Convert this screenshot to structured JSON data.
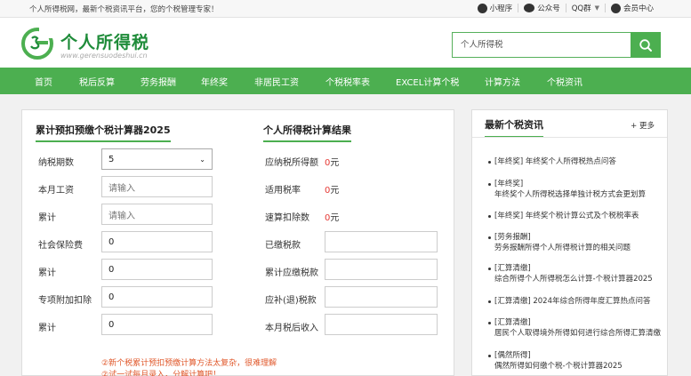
{
  "topbar": {
    "slogan": "个人所得税网，最新个税资讯平台，您的个税管理专家！",
    "miniprogram": "小程序",
    "official_account": "公众号",
    "qq_group": "QQ群",
    "member_center": "会员中心"
  },
  "header": {
    "site_title": "个人所得税",
    "site_url": "www.gerensuodeshui.cn",
    "search_placeholder": "个人所得税"
  },
  "nav": [
    "首页",
    "税后反算",
    "劳务报酬",
    "年终奖",
    "非居民工资",
    "个税税率表",
    "EXCEL计算个税",
    "计算方法",
    "个税资讯"
  ],
  "calculator": {
    "title": "累计预扣预缴个税计算器2025",
    "fields": [
      {
        "label": "纳税期数",
        "value": "5",
        "placeholder": ""
      },
      {
        "label": "本月工资",
        "value": "",
        "placeholder": "请输入"
      },
      {
        "label": "累计",
        "value": "",
        "placeholder": "请输入"
      },
      {
        "label": "社会保险费",
        "value": "0",
        "placeholder": ""
      },
      {
        "label": "累计",
        "value": "0",
        "placeholder": ""
      },
      {
        "label": "专项附加扣除",
        "value": "0",
        "placeholder": ""
      },
      {
        "label": "累计",
        "value": "0",
        "placeholder": ""
      }
    ],
    "note_line1": "②新个税累计预扣预缴计算方法太复杂，很难理解",
    "note_line2": "②试一试每月录入，分解计算吧！"
  },
  "result": {
    "title": "个人所得税计算结果",
    "items": [
      {
        "label": "应纳税所得额",
        "value": "0",
        "unit": "元"
      },
      {
        "label": "适用税率",
        "value": "0",
        "unit": "元"
      },
      {
        "label": "速算扣除数",
        "value": "0",
        "unit": "元"
      }
    ],
    "boxes": [
      "已缴税款",
      "累计应缴税款",
      "应补(退)税款",
      "本月税后收入"
    ]
  },
  "news": {
    "title": "最新个税资讯",
    "more": "+ 更多",
    "items": [
      {
        "tag": "[年终奖]",
        "text": "年终奖个人所得税热点问答",
        "two_line": false
      },
      {
        "tag": "[年终奖]",
        "text": "年终奖个人所得税选择单独计税方式会更划算",
        "two_line": true
      },
      {
        "tag": "[年终奖]",
        "text": "年终奖个税计算公式及个税税率表",
        "two_line": false
      },
      {
        "tag": "[劳务报酬]",
        "text": "劳务报酬所得个人所得税计算的相关问题",
        "two_line": true
      },
      {
        "tag": "[汇算清缴]",
        "text": "综合所得个人所得税怎么计算-个税计算器2025",
        "two_line": true
      },
      {
        "tag": "[汇算清缴]",
        "text": "2024年综合所得年度汇算热点问答",
        "two_line": false
      },
      {
        "tag": "[汇算清缴]",
        "text": "居民个人取得境外所得如何进行综合所得汇算清缴",
        "two_line": true
      },
      {
        "tag": "[偶然所得]",
        "text": "偶然所得如何缴个税-个税计算器2025",
        "two_line": true
      }
    ]
  },
  "colors": {
    "brand_green": "#4caf50",
    "logo_green": "#1f8c3a",
    "result_red": "#e53935",
    "note_orange": "#e0582b"
  }
}
